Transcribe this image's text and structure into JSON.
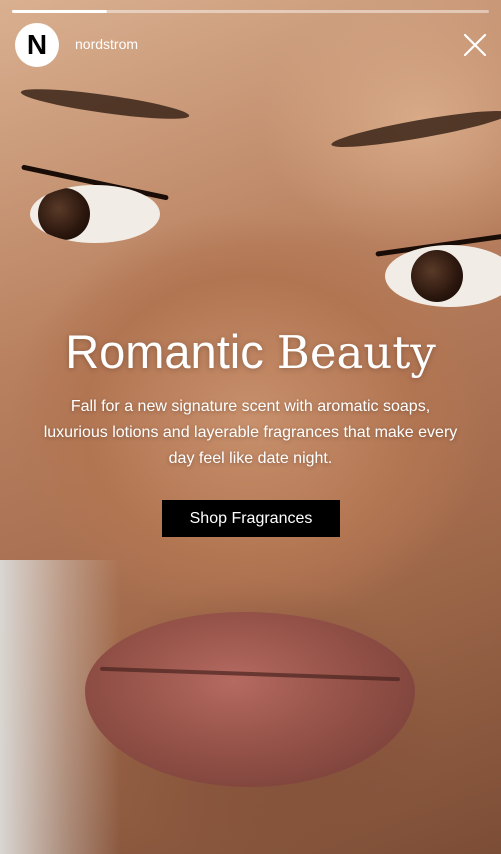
{
  "story": {
    "progress": 0.2,
    "account": {
      "avatar_letter": "N",
      "username": "nordstrom"
    },
    "close_icon": "close-icon"
  },
  "content": {
    "headline_part1": "Romantic",
    "headline_part2": "Beauty",
    "body": "Fall for a new signature scent with aromatic soaps, luxurious lotions and layerable fragrances that make every day feel like date night.",
    "cta_label": "Shop Fragrances"
  },
  "colors": {
    "cta_bg": "#000000",
    "text": "#ffffff"
  }
}
